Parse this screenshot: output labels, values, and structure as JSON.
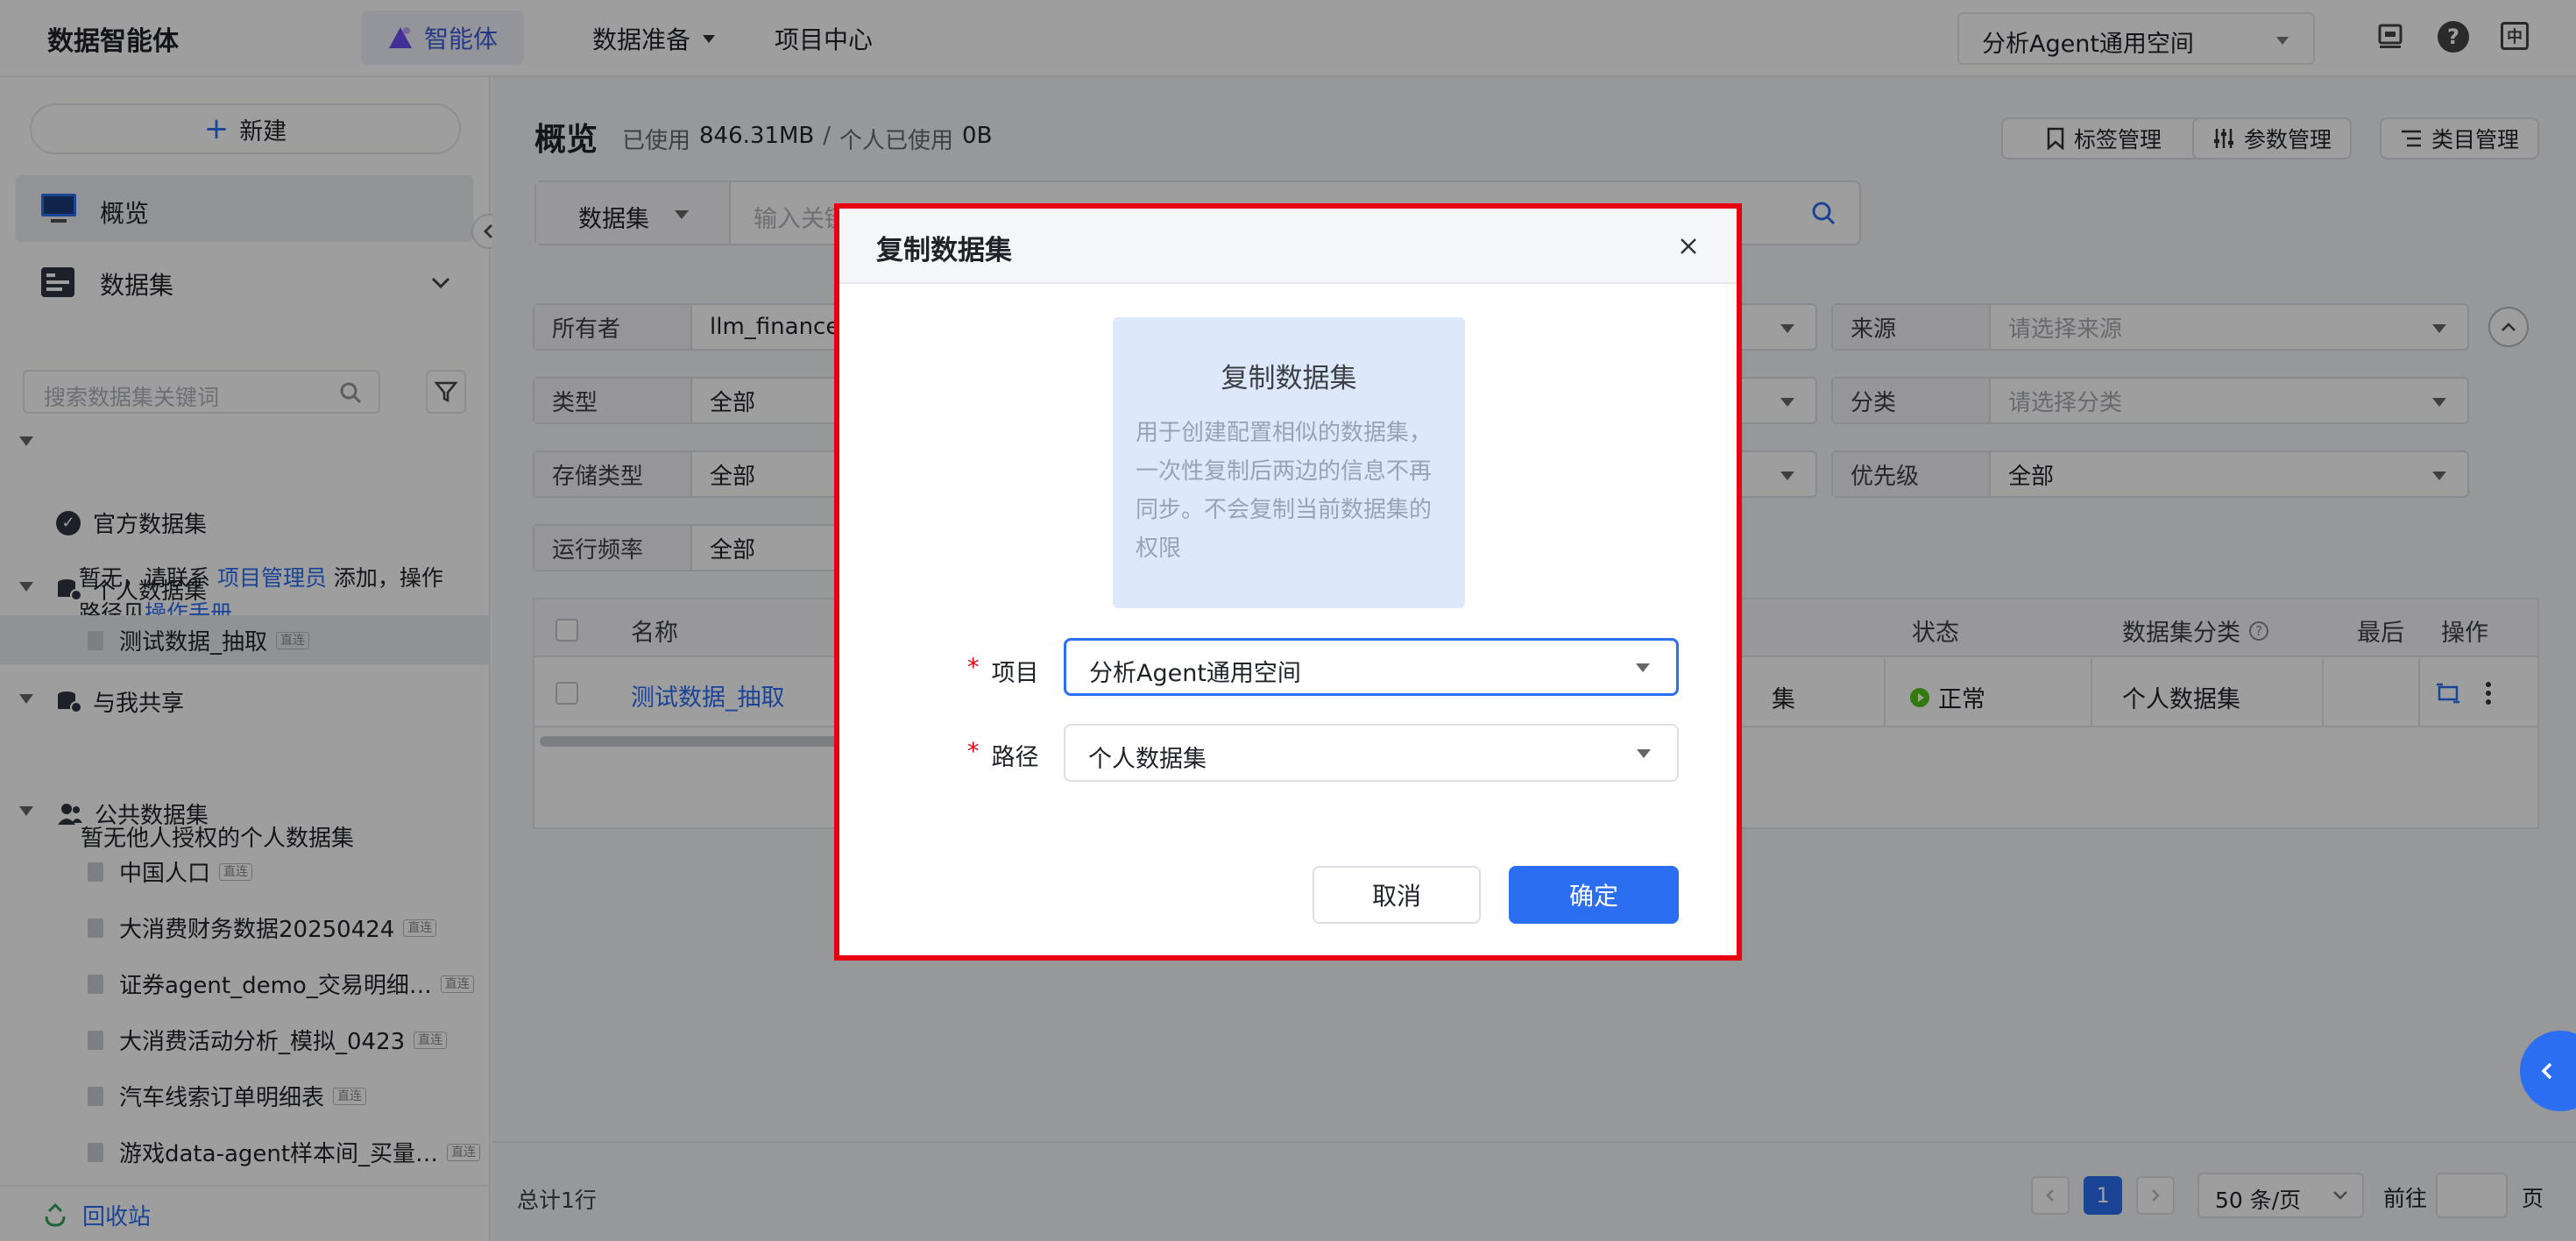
{
  "header": {
    "app_title": "数据智能体",
    "nav": {
      "agent": "智能体",
      "data_prep": "数据准备",
      "project_center": "项目中心"
    },
    "workspace": "分析Agent通用空间",
    "icons": [
      "monitor-icon",
      "help-icon",
      "lang-icon"
    ],
    "lang_label": "中"
  },
  "sidebar": {
    "new_label": "新建",
    "overview_label": "概览",
    "datasets_label": "数据集",
    "search_placeholder": "搜索数据集关键词",
    "official": {
      "title": "官方数据集",
      "note_prefix": "暂无，请联系 ",
      "note_link1": "项目管理员",
      "note_mid": " 添加，操作路径见",
      "note_link2": "操作手册"
    },
    "personal": {
      "title": "个人数据集",
      "items": [
        {
          "label": "测试数据_抽取",
          "tag": "直连"
        }
      ]
    },
    "shared": {
      "title": "与我共享",
      "empty": "暂无他人授权的个人数据集"
    },
    "public": {
      "title": "公共数据集",
      "items": [
        {
          "label": "中国人口",
          "tag": "直连"
        },
        {
          "label": "大消费财务数据20250424",
          "tag": "直连"
        },
        {
          "label": "证券agent_demo_交易明细…",
          "tag": "直连"
        },
        {
          "label": "大消费活动分析_模拟_0423",
          "tag": "直连"
        },
        {
          "label": "汽车线索订单明细表",
          "tag": "直连"
        },
        {
          "label": "游戏data-agent样本间_买量…",
          "tag": "直连"
        }
      ]
    },
    "recycle_label": "回收站"
  },
  "main": {
    "title": "概览",
    "usage": {
      "used_label": "已使用",
      "used_value": "846.31MB",
      "sep": "/",
      "personal_label": "个人已使用",
      "personal_value": "0B"
    },
    "actions": {
      "tags": "标签管理",
      "params": "参数管理",
      "categories": "类目管理"
    },
    "search": {
      "type_label": "数据集",
      "placeholder": "输入关键词"
    },
    "filters": {
      "owner": {
        "label": "所有者",
        "value": "llm_finance_"
      },
      "type": {
        "label": "类型",
        "value": "全部"
      },
      "storage": {
        "label": "存储类型",
        "value": "全部"
      },
      "frequency": {
        "label": "运行频率",
        "value": "全部"
      },
      "source": {
        "label": "来源",
        "placeholder": "请选择来源"
      },
      "category": {
        "label": "分类",
        "placeholder": "请选择分类"
      },
      "priority": {
        "label": "优先级",
        "value": "全部"
      }
    },
    "table": {
      "headers": {
        "name": "名称",
        "status": "状态",
        "classification": "数据集分类",
        "last": "最后",
        "ops": "操作"
      },
      "row": {
        "name": "测试数据_抽取",
        "mid": "集",
        "status": "正常",
        "classification": "个人数据集"
      },
      "status_color": "#52c41a"
    },
    "pagination": {
      "total": "总计1行",
      "current": "1",
      "page_size": "50 条/页",
      "goto_label": "前往",
      "page_suffix": "页"
    }
  },
  "dialog": {
    "title": "复制数据集",
    "card_title": "复制数据集",
    "card_desc": "用于创建配置相似的数据集，一次性复制后两边的信息不再同步。不会复制当前数据集的权限",
    "project_label": "项目",
    "project_value": "分析Agent通用空间",
    "path_label": "路径",
    "path_value": "个人数据集",
    "cancel_label": "取消",
    "confirm_label": "确定",
    "highlight_color": "#e60012",
    "primary_color": "#2b6ef2"
  }
}
